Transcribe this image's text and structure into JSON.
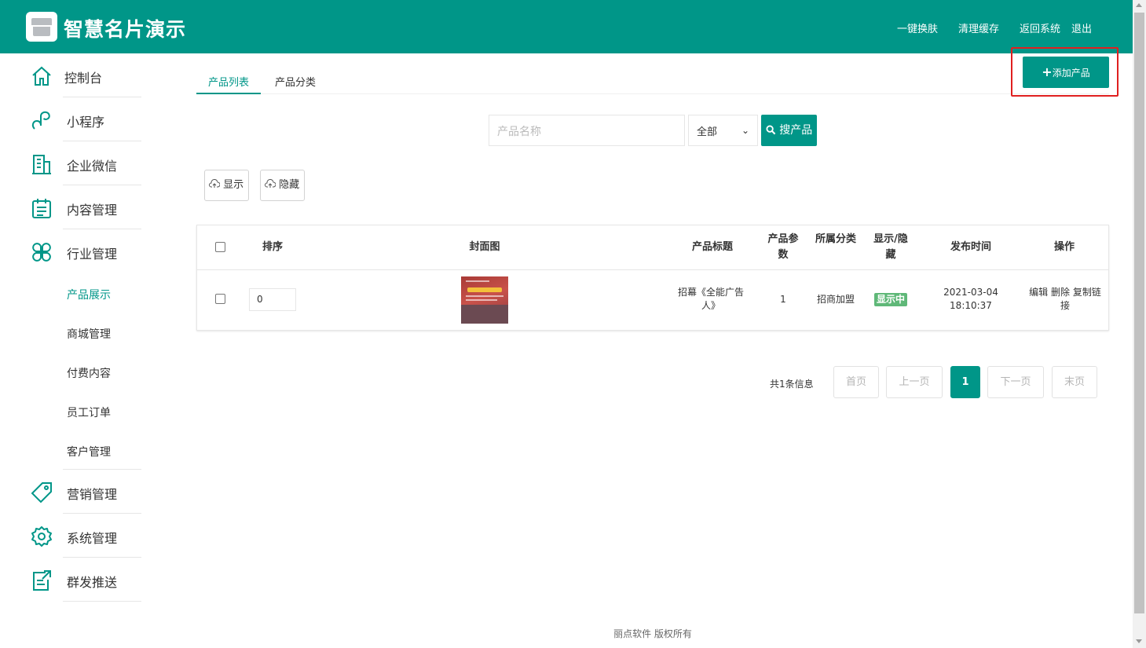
{
  "header": {
    "title": "智慧名片演示",
    "links": [
      "一键换肤",
      "清理缓存",
      "返回系统",
      "退出"
    ]
  },
  "sidebar": {
    "items": [
      {
        "label": "控制台",
        "icon": "home-icon"
      },
      {
        "label": "小程序",
        "icon": "miniprogram-icon"
      },
      {
        "label": "企业微信",
        "icon": "building-icon"
      },
      {
        "label": "内容管理",
        "icon": "clipboard-icon"
      },
      {
        "label": "行业管理",
        "icon": "clover-icon"
      },
      {
        "label": "营销管理",
        "icon": "tag-icon"
      },
      {
        "label": "系统管理",
        "icon": "gear-icon"
      },
      {
        "label": "群发推送",
        "icon": "edit-share-icon"
      }
    ],
    "sub_items": [
      "产品展示",
      "商城管理",
      "付费内容",
      "员工订单",
      "客户管理"
    ]
  },
  "tabs": [
    "产品列表",
    "产品分类"
  ],
  "add_button": "添加产品",
  "search": {
    "placeholder": "产品名称",
    "select_value": "全部",
    "button": "搜产品"
  },
  "bulk_actions": [
    "显示",
    "隐藏"
  ],
  "table": {
    "headers": [
      "排序",
      "封面图",
      "产品标题",
      "产品参数",
      "所属分类",
      "显示/隐藏",
      "发布时间",
      "操作"
    ],
    "rows": [
      {
        "sort": "0",
        "title": "招幕《全能广告人》",
        "params": "1",
        "category": "招商加盟",
        "status": "显示中",
        "time": "2021-03-04 18:10:37",
        "actions": [
          "编辑",
          "删除",
          "复制链接"
        ]
      }
    ]
  },
  "pagination": {
    "total": "共1条信息",
    "first": "首页",
    "prev": "上一页",
    "current": "1",
    "next": "下一页",
    "last": "末页"
  },
  "footer": "丽点软件 版权所有",
  "colors": {
    "primary": "#009688",
    "badge": "#5fb878",
    "highlight": "#e02020"
  }
}
